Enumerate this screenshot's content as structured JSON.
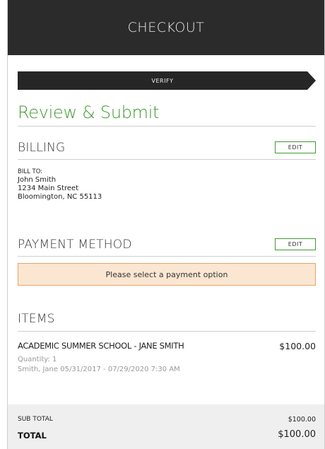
{
  "header": {
    "title": "CHECKOUT"
  },
  "progress": {
    "current_step": "VERIFY"
  },
  "review": {
    "title": "Review & Submit"
  },
  "billing": {
    "title": "BILLING",
    "edit_label": "EDIT",
    "bill_to_label": "BILL TO:",
    "name": "John Smith",
    "street": "1234 Main Street",
    "city_line": "Bloomington, NC 55113"
  },
  "payment": {
    "title": "PAYMENT METHOD",
    "edit_label": "EDIT",
    "alert_text": "Please select a payment option"
  },
  "items": {
    "title": "ITEMS",
    "list": [
      {
        "name": "ACADEMIC SUMMER SCHOOL - JANE SMITH",
        "price": "$100.00",
        "quantity": "Quantity: 1",
        "detail": "Smith, Jane 05/31/2017 - 07/29/2020 7:30 AM"
      }
    ]
  },
  "totals": {
    "sub_total_label": "SUB TOTAL",
    "sub_total_value": "$100.00",
    "total_label": "TOTAL",
    "total_value": "$100.00"
  },
  "colors": {
    "header_bg": "#2b2b2b",
    "accent_green": "#3e9a2f",
    "alert_bg": "#fbe6d2",
    "alert_border": "#e8a366",
    "totals_bg": "#efefef"
  }
}
